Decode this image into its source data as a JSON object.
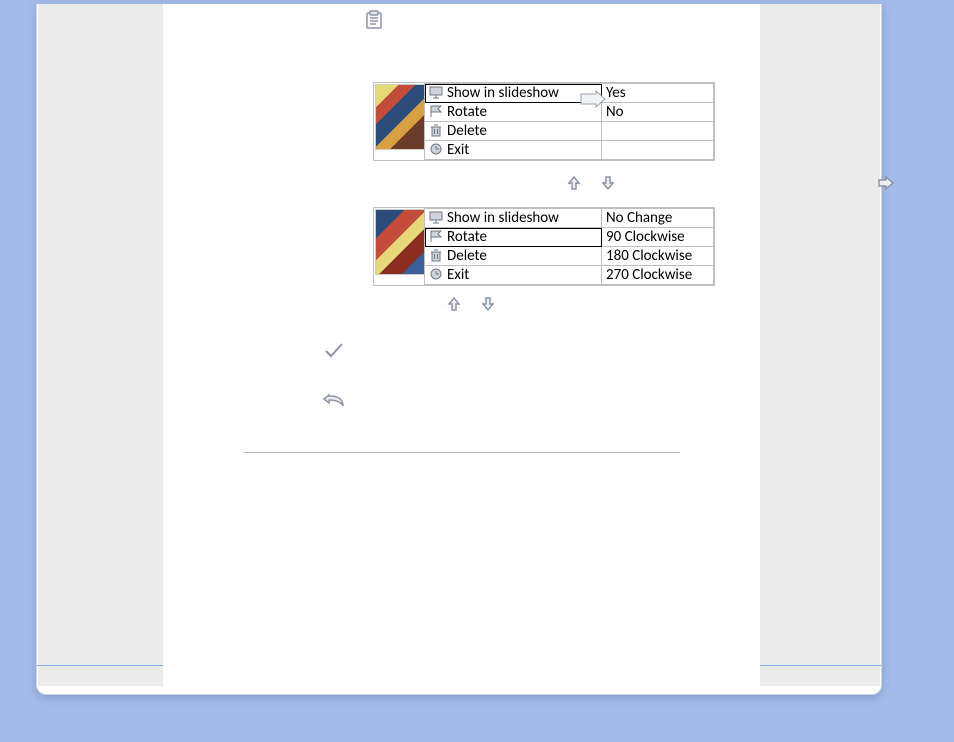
{
  "block1": {
    "selected_index": 0,
    "rows": [
      {
        "icon": "slideshow-icon",
        "label": "Show in slideshow",
        "value": "Yes"
      },
      {
        "icon": "flag-icon",
        "label": "Rotate",
        "value": "No"
      },
      {
        "icon": "trash-icon",
        "label": "Delete",
        "value": ""
      },
      {
        "icon": "clock-icon",
        "label": "Exit",
        "value": ""
      }
    ]
  },
  "block2": {
    "selected_index": 1,
    "rows": [
      {
        "icon": "slideshow-icon",
        "label": "Show in slideshow",
        "value": "No Change"
      },
      {
        "icon": "flag-icon",
        "label": "Rotate",
        "value": "90 Clockwise"
      },
      {
        "icon": "trash-icon",
        "label": "Delete",
        "value": "180 Clockwise"
      },
      {
        "icon": "clock-icon",
        "label": "Exit",
        "value": "270 Clockwise"
      }
    ]
  }
}
